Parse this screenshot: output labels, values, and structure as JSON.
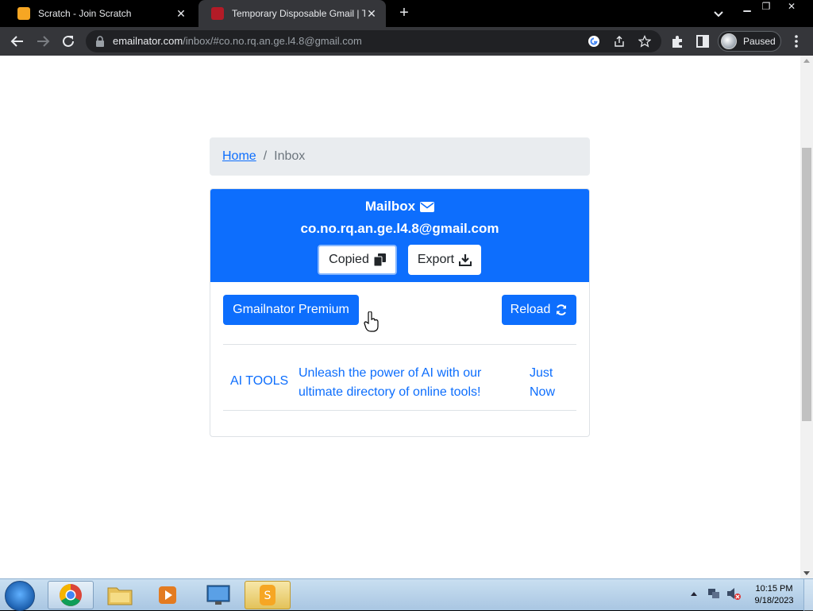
{
  "browser": {
    "tabs": [
      {
        "title": "Scratch - Join Scratch",
        "active": false,
        "favicon_color": "#f6a623"
      },
      {
        "title": "Temporary Disposable Gmail | Te",
        "active": true,
        "favicon_color": "#b31b27"
      }
    ],
    "address": {
      "host": "emailnator.com",
      "path": "/inbox/#co.no.rq.an.ge.l4.8@gmail.com"
    },
    "profile_label": "Paused"
  },
  "page": {
    "breadcrumb": {
      "home": "Home",
      "separator": "/",
      "current": "Inbox"
    },
    "mailbox": {
      "title": "Mailbox",
      "email": "co.no.rq.an.ge.l4.8@gmail.com",
      "copy_label": "Copied",
      "export_label": "Export"
    },
    "actions": {
      "premium_label": "Gmailnator Premium",
      "reload_label": "Reload"
    },
    "messages": [
      {
        "from": "AI TOOLS",
        "subject": "Unleash the power of AI with our ultimate directory of online tools!",
        "time": "Just Now"
      }
    ],
    "colors": {
      "primary": "#0d6efd",
      "breadcrumb_bg": "#e9ecef"
    }
  },
  "taskbar": {
    "clock_time": "10:15 PM",
    "clock_date": "9/18/2023"
  }
}
